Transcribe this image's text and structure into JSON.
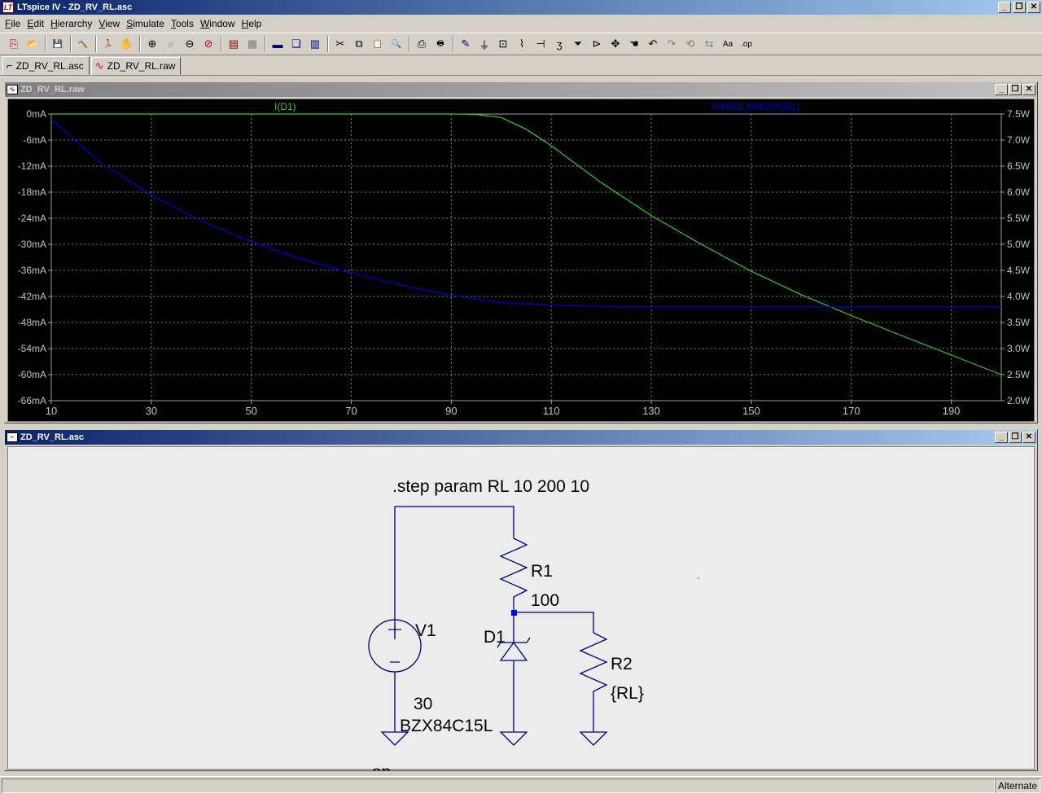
{
  "app": {
    "title": "LTspice IV - ZD_RV_RL.asc",
    "icon": "ltspice-logo-icon"
  },
  "window_buttons": {
    "minimize": "_",
    "restore": "❐",
    "close": "✕"
  },
  "menu": [
    {
      "label": "File"
    },
    {
      "label": "Edit"
    },
    {
      "label": "Hierarchy"
    },
    {
      "label": "View"
    },
    {
      "label": "Simulate"
    },
    {
      "label": "Tools"
    },
    {
      "label": "Window"
    },
    {
      "label": "Help"
    }
  ],
  "toolbar": [
    {
      "icon": "new-schematic-icon",
      "glyph": "⎘",
      "color": "#c00000"
    },
    {
      "icon": "open-icon",
      "glyph": "📂",
      "color": "#806000"
    },
    {
      "sep": true
    },
    {
      "icon": "save-icon",
      "glyph": "💾",
      "color": "#000080"
    },
    {
      "sep": true
    },
    {
      "icon": "control-panel-icon",
      "glyph": "🔨",
      "color": "#404040"
    },
    {
      "sep": true
    },
    {
      "icon": "run-icon",
      "glyph": "🏃",
      "color": "#404040"
    },
    {
      "icon": "halt-icon",
      "glyph": "✋",
      "color": "#808080"
    },
    {
      "sep": true
    },
    {
      "icon": "zoom-in-icon",
      "glyph": "⊕",
      "color": "#000"
    },
    {
      "icon": "pan-icon",
      "glyph": "⌕",
      "color": "#808080"
    },
    {
      "icon": "zoom-out-icon",
      "glyph": "⊖",
      "color": "#000"
    },
    {
      "icon": "zoom-fit-icon",
      "glyph": "⊘",
      "color": "#c00000"
    },
    {
      "sep": true
    },
    {
      "icon": "autorange-icon",
      "glyph": "▤",
      "color": "#800000"
    },
    {
      "icon": "fft-icon",
      "glyph": "▦",
      "color": "#808080"
    },
    {
      "sep": true
    },
    {
      "icon": "tile-horizontal-icon",
      "glyph": "▬",
      "color": "#000080"
    },
    {
      "icon": "cascade-icon",
      "glyph": "❏",
      "color": "#000080"
    },
    {
      "icon": "tile-vertical-icon",
      "glyph": "▥",
      "color": "#000080"
    },
    {
      "sep": true
    },
    {
      "icon": "cut-icon",
      "glyph": "✂",
      "color": "#000"
    },
    {
      "icon": "copy-icon",
      "glyph": "⧉",
      "color": "#000"
    },
    {
      "icon": "paste-icon",
      "glyph": "📋",
      "color": "#000"
    },
    {
      "icon": "find-icon",
      "glyph": "🔍",
      "color": "#000"
    },
    {
      "sep": true
    },
    {
      "icon": "print-setup-icon",
      "glyph": "⎙",
      "color": "#000"
    },
    {
      "icon": "print-icon",
      "glyph": "🖶",
      "color": "#000"
    },
    {
      "sep": true
    },
    {
      "icon": "draw-wire-icon",
      "glyph": "✎",
      "color": "#000080"
    },
    {
      "icon": "ground-icon",
      "glyph": "⏚",
      "color": "#000"
    },
    {
      "icon": "label-net-icon",
      "glyph": "⊡",
      "color": "#000"
    },
    {
      "icon": "resistor-icon",
      "glyph": "⌇",
      "color": "#000"
    },
    {
      "icon": "capacitor-icon",
      "glyph": "⊣",
      "color": "#000"
    },
    {
      "icon": "inductor-icon",
      "glyph": "ʒ",
      "color": "#000"
    },
    {
      "icon": "diode-icon",
      "glyph": "⏷",
      "color": "#000"
    },
    {
      "icon": "component-icon",
      "glyph": "⊳",
      "color": "#000"
    },
    {
      "icon": "move-icon",
      "glyph": "✥",
      "color": "#000"
    },
    {
      "icon": "drag-icon",
      "glyph": "☚",
      "color": "#000"
    },
    {
      "icon": "undo-icon",
      "glyph": "↶",
      "color": "#000"
    },
    {
      "icon": "redo-icon",
      "glyph": "↷",
      "color": "#808080"
    },
    {
      "icon": "rotate-icon",
      "glyph": "⟲",
      "color": "#808080"
    },
    {
      "icon": "mirror-icon",
      "glyph": "⇆",
      "color": "#808080"
    },
    {
      "icon": "text-icon",
      "glyph": "Aa",
      "color": "#000"
    },
    {
      "icon": "spice-directive-icon",
      "glyph": ".op",
      "color": "#000"
    }
  ],
  "tabs": [
    {
      "label": "ZD_RV_RL.asc",
      "icon": "schematic-tab-icon",
      "active": true
    },
    {
      "label": "ZD_RV_RL.raw",
      "icon": "waveform-tab-icon",
      "active": false
    }
  ],
  "waveform_window": {
    "title": "ZD_RV_RL.raw",
    "icon": "waveform-window-icon"
  },
  "schematic_window": {
    "title": "ZD_RV_RL.asc",
    "icon": "schematic-window-icon"
  },
  "chart_data": {
    "type": "line",
    "background": "#000000",
    "grid": true,
    "grid_color": "#808080",
    "x_ticks": [
      "10",
      "30",
      "50",
      "70",
      "90",
      "110",
      "130",
      "150",
      "170",
      "190"
    ],
    "xlim": [
      10,
      200
    ],
    "left_axis": {
      "ticks": [
        "0mA",
        "-6mA",
        "-12mA",
        "-18mA",
        "-24mA",
        "-30mA",
        "-36mA",
        "-42mA",
        "-48mA",
        "-54mA",
        "-60mA",
        "-66mA"
      ],
      "ylim": [
        -66,
        0
      ],
      "unit": "mA"
    },
    "right_axis": {
      "ticks": [
        "7.5W",
        "7.0W",
        "6.5W",
        "6.0W",
        "5.5W",
        "5.0W",
        "4.5W",
        "4.0W",
        "3.5W",
        "3.0W",
        "2.5W",
        "2.0W"
      ],
      "ylim": [
        2.0,
        7.5
      ],
      "unit": "W"
    },
    "series": [
      {
        "name": "I(D1)",
        "axis": "left",
        "color": "#33cc33",
        "x": [
          10,
          20,
          30,
          40,
          50,
          60,
          70,
          80,
          90,
          95,
          100,
          105,
          110,
          120,
          130,
          140,
          150,
          160,
          170,
          180,
          190,
          200
        ],
        "y": [
          0,
          0,
          0,
          0,
          0,
          0,
          0,
          0,
          0,
          -0.1,
          -0.8,
          -3.5,
          -7.3,
          -15.8,
          -23.4,
          -30.0,
          -36.2,
          -41.6,
          -46.4,
          -51.0,
          -55.5,
          -60.0
        ]
      },
      {
        "name": "V(N001,N002)*I(R1)",
        "axis": "right",
        "color": "#0000dd",
        "x": [
          10,
          20,
          30,
          40,
          50,
          60,
          70,
          80,
          90,
          100,
          110,
          120,
          130,
          140,
          150,
          160,
          170,
          180,
          190,
          200
        ],
        "y": [
          7.4,
          6.55,
          5.95,
          5.45,
          5.05,
          4.72,
          4.45,
          4.22,
          4.02,
          3.88,
          3.83,
          3.81,
          3.8,
          3.8,
          3.8,
          3.8,
          3.8,
          3.8,
          3.8,
          3.8
        ]
      }
    ]
  },
  "schematic": {
    "directive_step": ".step param RL 10 200 10",
    "directive_op": ".op",
    "wire_color": "#000080",
    "components": {
      "v1": {
        "name": "V1",
        "value": "30"
      },
      "r1": {
        "name": "R1",
        "value": "100"
      },
      "d1": {
        "name": "D1",
        "value": "BZX84C15L"
      },
      "r2": {
        "name": "R2",
        "value": "{RL}"
      }
    }
  },
  "status": {
    "mode": "Alternate"
  }
}
